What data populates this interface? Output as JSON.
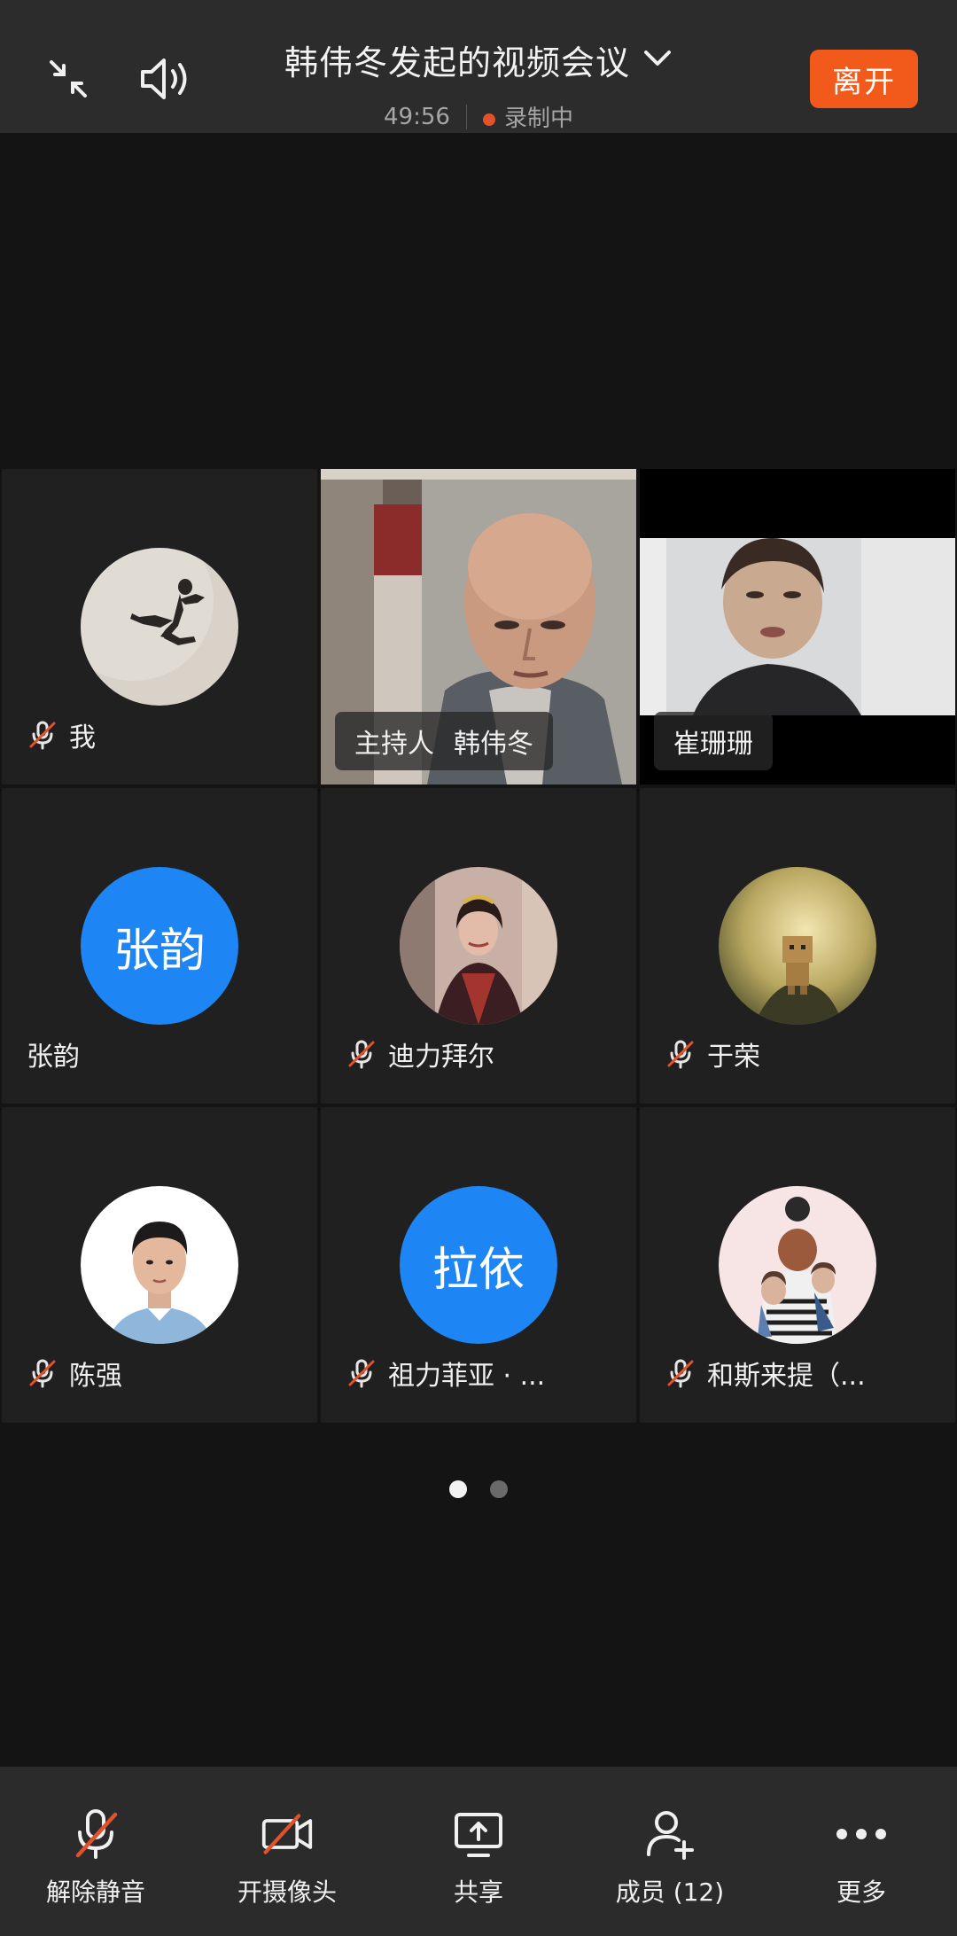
{
  "header": {
    "title": "韩伟冬发起的视频会议",
    "timer": "49:56",
    "recording": "录制中",
    "leave": "离开"
  },
  "participants": [
    {
      "name": "我",
      "mic_muted": true,
      "kind": "photo"
    },
    {
      "host_tag": "主持人",
      "name": "韩伟冬",
      "kind": "video"
    },
    {
      "name": "崔珊珊",
      "kind": "video"
    },
    {
      "name": "张韵",
      "avatar_text": "张韵",
      "mic_muted": false,
      "kind": "text"
    },
    {
      "name": "迪力拜尔",
      "mic_muted": true,
      "kind": "photo"
    },
    {
      "name": "于荣",
      "mic_muted": true,
      "kind": "photo"
    },
    {
      "name": "陈强",
      "mic_muted": true,
      "kind": "photo"
    },
    {
      "name": "祖力菲亚 · ...",
      "avatar_text": "拉依",
      "mic_muted": true,
      "kind": "text"
    },
    {
      "name": "和斯来提（...",
      "mic_muted": true,
      "kind": "photo"
    }
  ],
  "pagination": {
    "current": 1,
    "total": 2
  },
  "toolbar": {
    "unmute": "解除静音",
    "camera": "开摄像头",
    "share": "共享",
    "members": "成员 (12)",
    "more": "更多"
  },
  "colors": {
    "accent": "#1d86f4",
    "leave": "#f25a1b",
    "mute_slash": "#e1512b",
    "recording_dot": "#e1512b"
  },
  "icons": [
    "minimize-icon",
    "speaker-icon",
    "chevron-down-icon",
    "mic-off-icon",
    "camera-off-icon",
    "share-screen-icon",
    "add-member-icon",
    "more-icon"
  ]
}
